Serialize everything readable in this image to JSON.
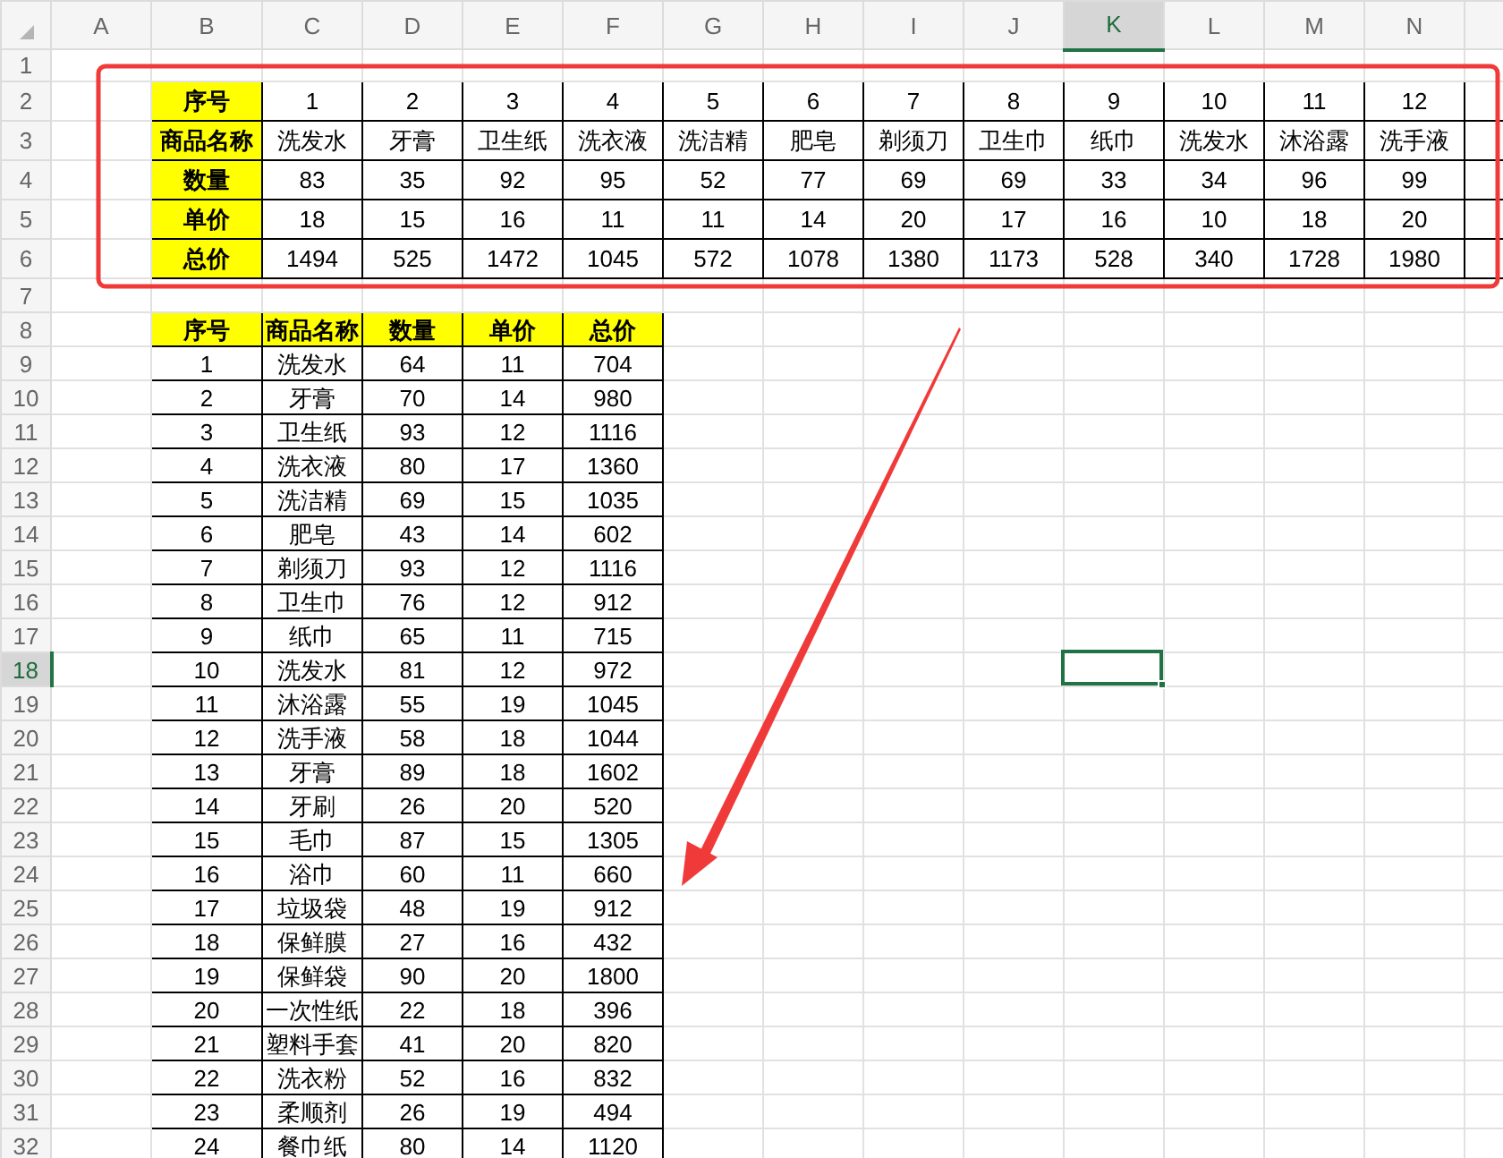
{
  "column_headers": [
    {
      "label": "A",
      "selected": false
    },
    {
      "label": "B",
      "selected": false
    },
    {
      "label": "C",
      "selected": false
    },
    {
      "label": "D",
      "selected": false
    },
    {
      "label": "E",
      "selected": false
    },
    {
      "label": "F",
      "selected": false
    },
    {
      "label": "G",
      "selected": false
    },
    {
      "label": "H",
      "selected": false
    },
    {
      "label": "I",
      "selected": false
    },
    {
      "label": "J",
      "selected": false
    },
    {
      "label": "K",
      "selected": true
    },
    {
      "label": "L",
      "selected": false
    },
    {
      "label": "M",
      "selected": false
    },
    {
      "label": "N",
      "selected": false
    }
  ],
  "row_headers": [
    {
      "label": "1",
      "selected": false
    },
    {
      "label": "2",
      "selected": false
    },
    {
      "label": "3",
      "selected": false
    },
    {
      "label": "4",
      "selected": false
    },
    {
      "label": "5",
      "selected": false
    },
    {
      "label": "6",
      "selected": false
    },
    {
      "label": "7",
      "selected": false
    },
    {
      "label": "8",
      "selected": false
    },
    {
      "label": "9",
      "selected": false
    },
    {
      "label": "10",
      "selected": false
    },
    {
      "label": "11",
      "selected": false
    },
    {
      "label": "12",
      "selected": false
    },
    {
      "label": "13",
      "selected": false
    },
    {
      "label": "14",
      "selected": false
    },
    {
      "label": "15",
      "selected": false
    },
    {
      "label": "16",
      "selected": false
    },
    {
      "label": "17",
      "selected": false
    },
    {
      "label": "18",
      "selected": true
    },
    {
      "label": "19",
      "selected": false
    },
    {
      "label": "20",
      "selected": false
    },
    {
      "label": "21",
      "selected": false
    },
    {
      "label": "22",
      "selected": false
    },
    {
      "label": "23",
      "selected": false
    },
    {
      "label": "24",
      "selected": false
    },
    {
      "label": "25",
      "selected": false
    },
    {
      "label": "26",
      "selected": false
    },
    {
      "label": "27",
      "selected": false
    },
    {
      "label": "28",
      "selected": false
    },
    {
      "label": "29",
      "selected": false
    },
    {
      "label": "30",
      "selected": false
    },
    {
      "label": "31",
      "selected": false
    },
    {
      "label": "32",
      "selected": false
    }
  ],
  "horizontal_table": {
    "rows": [
      {
        "label": "序号",
        "cells": [
          "1",
          "2",
          "3",
          "4",
          "5",
          "6",
          "7",
          "8",
          "9",
          "10",
          "11",
          "12"
        ]
      },
      {
        "label": "商品名称",
        "cells": [
          "洗发水",
          "牙膏",
          "卫生纸",
          "洗衣液",
          "洗洁精",
          "肥皂",
          "剃须刀",
          "卫生巾",
          "纸巾",
          "洗发水",
          "沐浴露",
          "洗手液"
        ]
      },
      {
        "label": "数量",
        "cells": [
          "83",
          "35",
          "92",
          "95",
          "52",
          "77",
          "69",
          "69",
          "33",
          "34",
          "96",
          "99"
        ]
      },
      {
        "label": "单价",
        "cells": [
          "18",
          "15",
          "16",
          "11",
          "11",
          "14",
          "20",
          "17",
          "16",
          "10",
          "18",
          "20"
        ]
      },
      {
        "label": "总价",
        "cells": [
          "1494",
          "525",
          "1472",
          "1045",
          "572",
          "1078",
          "1380",
          "1173",
          "528",
          "340",
          "1728",
          "1980"
        ]
      }
    ]
  },
  "vertical_table": {
    "columns": [
      "序号",
      "商品名称",
      "数量",
      "单价",
      "总价"
    ],
    "rows": [
      [
        "1",
        "洗发水",
        "64",
        "11",
        "704"
      ],
      [
        "2",
        "牙膏",
        "70",
        "14",
        "980"
      ],
      [
        "3",
        "卫生纸",
        "93",
        "12",
        "1116"
      ],
      [
        "4",
        "洗衣液",
        "80",
        "17",
        "1360"
      ],
      [
        "5",
        "洗洁精",
        "69",
        "15",
        "1035"
      ],
      [
        "6",
        "肥皂",
        "43",
        "14",
        "602"
      ],
      [
        "7",
        "剃须刀",
        "93",
        "12",
        "1116"
      ],
      [
        "8",
        "卫生巾",
        "76",
        "12",
        "912"
      ],
      [
        "9",
        "纸巾",
        "65",
        "11",
        "715"
      ],
      [
        "10",
        "洗发水",
        "81",
        "12",
        "972"
      ],
      [
        "11",
        "沐浴露",
        "55",
        "19",
        "1045"
      ],
      [
        "12",
        "洗手液",
        "58",
        "18",
        "1044"
      ],
      [
        "13",
        "牙膏",
        "89",
        "18",
        "1602"
      ],
      [
        "14",
        "牙刷",
        "26",
        "20",
        "520"
      ],
      [
        "15",
        "毛巾",
        "87",
        "15",
        "1305"
      ],
      [
        "16",
        "浴巾",
        "60",
        "11",
        "660"
      ],
      [
        "17",
        "垃圾袋",
        "48",
        "19",
        "912"
      ],
      [
        "18",
        "保鲜膜",
        "27",
        "16",
        "432"
      ],
      [
        "19",
        "保鲜袋",
        "90",
        "20",
        "1800"
      ],
      [
        "20",
        "一次性纸",
        "22",
        "18",
        "396"
      ],
      [
        "21",
        "塑料手套",
        "41",
        "20",
        "820"
      ],
      [
        "22",
        "洗衣粉",
        "52",
        "16",
        "832"
      ],
      [
        "23",
        "柔顺剂",
        "26",
        "19",
        "494"
      ],
      [
        "24",
        "餐巾纸",
        "80",
        "14",
        "1120"
      ]
    ]
  }
}
